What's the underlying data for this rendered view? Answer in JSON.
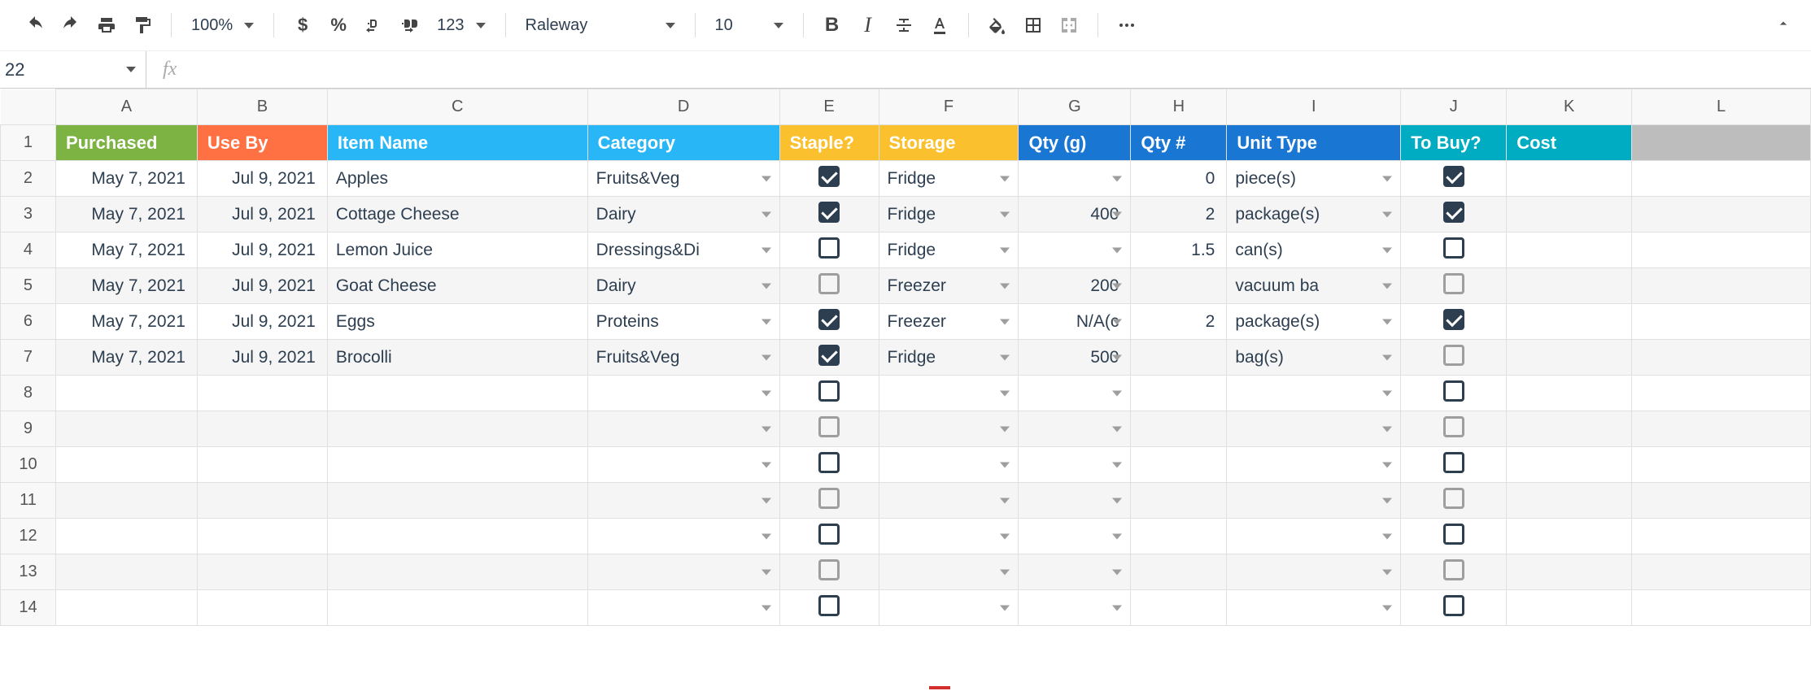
{
  "toolbar": {
    "zoom": "100%",
    "currency_icon": "$",
    "percent_icon": "%",
    "font": "Raleway",
    "font_size": "10",
    "number_format_label": "123"
  },
  "name_box": {
    "value": "22"
  },
  "formula_bar": {
    "fx_label": "fx",
    "value": ""
  },
  "columns": [
    "A",
    "B",
    "C",
    "D",
    "E",
    "F",
    "G",
    "H",
    "I",
    "J",
    "K",
    "L"
  ],
  "row_numbers": [
    1,
    2,
    3,
    4,
    5,
    6,
    7,
    8,
    9,
    10,
    11,
    12,
    13,
    14
  ],
  "headers": {
    "A": {
      "label": "Purchased",
      "color": "green"
    },
    "B": {
      "label": "Use By",
      "color": "orange"
    },
    "C": {
      "label": "Item Name",
      "color": "sky"
    },
    "D": {
      "label": "Category",
      "color": "sky"
    },
    "E": {
      "label": "Staple?",
      "color": "yellow"
    },
    "F": {
      "label": "Storage",
      "color": "yellow"
    },
    "G": {
      "label": "Qty (g)",
      "color": "blue"
    },
    "H": {
      "label": "Qty #",
      "color": "blue"
    },
    "I": {
      "label": "Unit Type",
      "color": "blue"
    },
    "J": {
      "label": "To Buy?",
      "color": "teal"
    },
    "K": {
      "label": "Cost",
      "color": "teal"
    },
    "L": {
      "label": "",
      "color": "gray"
    }
  },
  "rows": [
    {
      "alt": false,
      "purchased": "May 7, 2021",
      "use_by": "Jul 9, 2021",
      "item": "Apples",
      "category": "Fruits&Veg",
      "staple": true,
      "storage": "Fridge",
      "qty_g": "",
      "qty_n": "0",
      "unit": "piece(s)",
      "to_buy": true,
      "cost": ""
    },
    {
      "alt": true,
      "purchased": "May 7, 2021",
      "use_by": "Jul 9, 2021",
      "item": "Cottage Cheese",
      "category": "Dairy",
      "staple": true,
      "storage": "Fridge",
      "qty_g": "400",
      "qty_n": "2",
      "unit": "package(s)",
      "to_buy": true,
      "cost": ""
    },
    {
      "alt": false,
      "purchased": "May 7, 2021",
      "use_by": "Jul 9, 2021",
      "item": "Lemon Juice",
      "category": "Dressings&Di",
      "staple": false,
      "storage": "Fridge",
      "qty_g": "",
      "qty_n": "1.5",
      "unit": "can(s)",
      "to_buy": false,
      "cost": ""
    },
    {
      "alt": true,
      "purchased": "May 7, 2021",
      "use_by": "Jul 9, 2021",
      "item": "Goat Cheese",
      "category": "Dairy",
      "staple": false,
      "storage": "Freezer",
      "qty_g": "200",
      "qty_n": "",
      "unit": "vacuum ba",
      "to_buy": false,
      "cost": ""
    },
    {
      "alt": false,
      "purchased": "May 7, 2021",
      "use_by": "Jul 9, 2021",
      "item": "Eggs",
      "category": "Proteins",
      "staple": true,
      "storage": "Freezer",
      "qty_g": "N/A(c",
      "qty_n": "2",
      "unit": "package(s)",
      "to_buy": true,
      "cost": ""
    },
    {
      "alt": true,
      "purchased": "May 7, 2021",
      "use_by": "Jul 9, 2021",
      "item": "Brocolli",
      "category": "Fruits&Veg",
      "staple": true,
      "storage": "Fridge",
      "qty_g": "500",
      "qty_n": "",
      "unit": "bag(s)",
      "to_buy": false,
      "cost": ""
    }
  ],
  "empty_rows": 7
}
